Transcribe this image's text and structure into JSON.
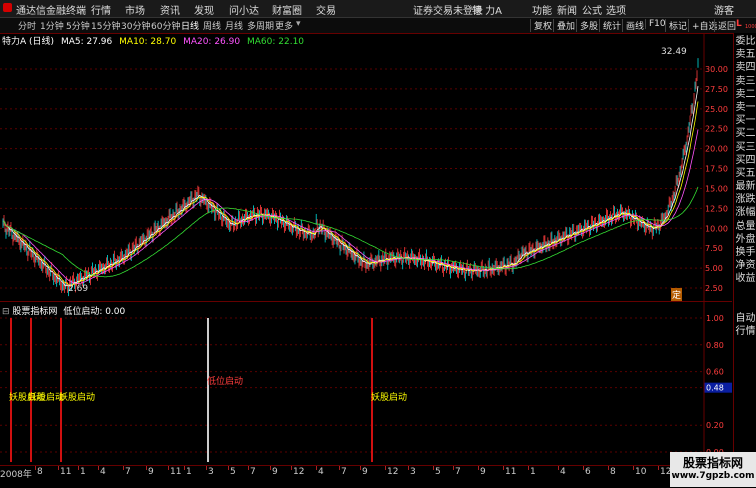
{
  "menubar": {
    "app_title": "通达信金融终端",
    "menus": [
      "行情",
      "市场",
      "资讯",
      "发现",
      "问小达",
      "财富圈",
      "交易"
    ],
    "notice": "证券交易未登录",
    "stock_name": "特 力A",
    "right_menus": [
      "功能",
      "新闻",
      "公式",
      "选项"
    ],
    "user": "游客"
  },
  "periodbar": {
    "periods": [
      "分时",
      "1分钟",
      "5分钟",
      "15分钟",
      "30分钟",
      "60分钟",
      "日线",
      "周线",
      "月线",
      "多周期",
      "更多"
    ],
    "selected": "日线",
    "tools": [
      "复权",
      "叠加",
      "多股",
      "统计",
      "画线",
      "F10",
      "标记",
      "+自选",
      "返回"
    ]
  },
  "main_header": {
    "stock": "特力A",
    "period": "(日线)",
    "ma5": "MA5: 27.96",
    "ma10": "MA10: 28.70",
    "ma20": "MA20: 26.90",
    "ma60": "MA60: 22.10"
  },
  "sub_header": {
    "title": "股票指标网",
    "indicator": "低位启动: 0.00"
  },
  "annotations": {
    "high_label": "32.49",
    "low_label": "2.69",
    "ding_label": "定"
  },
  "signals": {
    "label_a": "妖股启动",
    "label_b": "妖股启动",
    "label_c": "妖股启动",
    "label_d": "妖股启动",
    "label_e": "低位启动"
  },
  "y_axis_main": [
    "30.00",
    "27.50",
    "25.00",
    "22.50",
    "20.00",
    "17.50",
    "15.00",
    "12.50",
    "10.00",
    "7.50",
    "5.00",
    "2.50"
  ],
  "y_axis_sub": [
    "1.00",
    "0.80",
    "0.60",
    "0.48",
    "0.20",
    "0.00"
  ],
  "y_axis_corner": "1000",
  "x_axis": [
    "2008年",
    "8",
    "11",
    "1",
    "4",
    "7",
    "9",
    "11",
    "1",
    "3",
    "5",
    "7",
    "9",
    "12",
    "4",
    "7",
    "9",
    "12",
    "3",
    "5",
    "7",
    "9",
    "11",
    "1",
    "4",
    "6",
    "8",
    "10",
    "12"
  ],
  "right_panel": [
    "委比",
    "卖五",
    "卖四",
    "卖三",
    "卖二",
    "卖一",
    "买一",
    "买二",
    "买三",
    "买四",
    "买五",
    "最新",
    "涨跌",
    "涨幅",
    "总量",
    "外盘",
    "换手",
    "净资",
    "收益",
    "",
    "",
    "自动",
    "行情"
  ],
  "watermark": {
    "line1": "股票指标网",
    "line2": "www.7gpzb.com"
  },
  "colors": {
    "up": "#ff3d3d",
    "down": "#00ffff",
    "ma5": "#ffffff",
    "ma10": "#ffff00",
    "ma20": "#ff55ff",
    "ma60": "#33dd33",
    "grid": "#660000"
  }
}
